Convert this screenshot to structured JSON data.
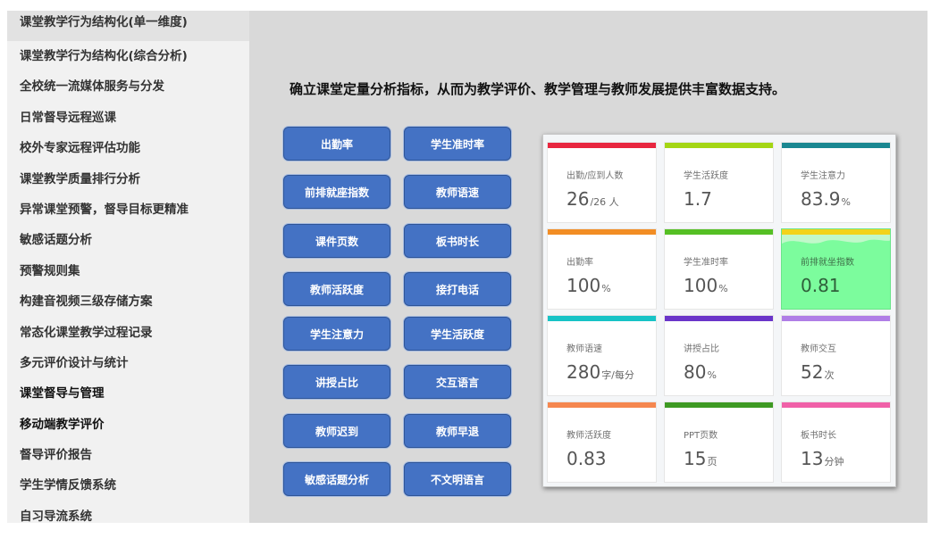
{
  "sidebar": {
    "items": [
      {
        "label": "课堂教学行为结构化(单一维度)"
      },
      {
        "label": "课堂教学行为结构化(综合分析)"
      },
      {
        "label": "全校统一流媒体服务与分发"
      },
      {
        "label": "日常督导远程巡课"
      },
      {
        "label": "校外专家远程评估功能"
      },
      {
        "label": "课堂教学质量排行分析"
      },
      {
        "label": "异常课堂预警，督导目标更精准"
      },
      {
        "label": "敏感话题分析"
      },
      {
        "label": "预警规则集"
      },
      {
        "label": "构建音视频三级存储方案"
      },
      {
        "label": "常态化课堂教学过程记录"
      },
      {
        "label": "多元评价设计与统计"
      },
      {
        "label": "课堂督导与管理"
      },
      {
        "label": "移动端教学评价"
      },
      {
        "label": "督导评价报告"
      },
      {
        "label": "学生学情反馈系统"
      },
      {
        "label": "自习导流系统"
      }
    ]
  },
  "main": {
    "headline": "确立课堂定量分析指标，从而为教学评价、教学管理与教师发展提供丰富数据支持。",
    "buttons": [
      {
        "label": "出勤率"
      },
      {
        "label": "学生准时率"
      },
      {
        "label": "前排就座指数"
      },
      {
        "label": "教师语速"
      },
      {
        "label": "课件页数"
      },
      {
        "label": "板书时长"
      },
      {
        "label": "教师活跃度"
      },
      {
        "label": "接打电话"
      },
      {
        "label": "学生注意力"
      },
      {
        "label": "学生活跃度"
      },
      {
        "label": "讲授占比"
      },
      {
        "label": "交互语言"
      },
      {
        "label": "教师迟到"
      },
      {
        "label": "教师早退"
      },
      {
        "label": "敏感话题分析"
      },
      {
        "label": "不文明语言"
      }
    ],
    "dashboard": {
      "cards": [
        {
          "label": "出勤/应到人数",
          "value": "26",
          "unit": "/26 人",
          "color": "#e8263f"
        },
        {
          "label": "学生活跃度",
          "value": "1.7",
          "unit": "",
          "color": "#a4d614"
        },
        {
          "label": "学生注意力",
          "value": "83.9",
          "unit": "%",
          "color": "#1a8791"
        },
        {
          "label": "出勤率",
          "value": "100",
          "unit": "%",
          "color": "#f28d24"
        },
        {
          "label": "学生准时率",
          "value": "100",
          "unit": "%",
          "color": "#55bf24"
        },
        {
          "label": "前排就坐指数",
          "value": "0.81",
          "unit": "",
          "color": "#f2d31b"
        },
        {
          "label": "教师语速",
          "value": "280",
          "unit": "字/每分",
          "color": "#17c3c6"
        },
        {
          "label": "讲授占比",
          "value": "80",
          "unit": "%",
          "color": "#6a35c9"
        },
        {
          "label": "教师交互",
          "value": "52",
          "unit": "次",
          "color": "#b07ee6"
        },
        {
          "label": "教师活跃度",
          "value": "0.83",
          "unit": "",
          "color": "#f5874f"
        },
        {
          "label": "PPT页数",
          "value": "15",
          "unit": "页",
          "color": "#3e9a23"
        },
        {
          "label": "板书时长",
          "value": "13",
          "unit": "分钟",
          "color": "#f060a8"
        }
      ],
      "highlight_color": "#7cfc9d"
    }
  }
}
